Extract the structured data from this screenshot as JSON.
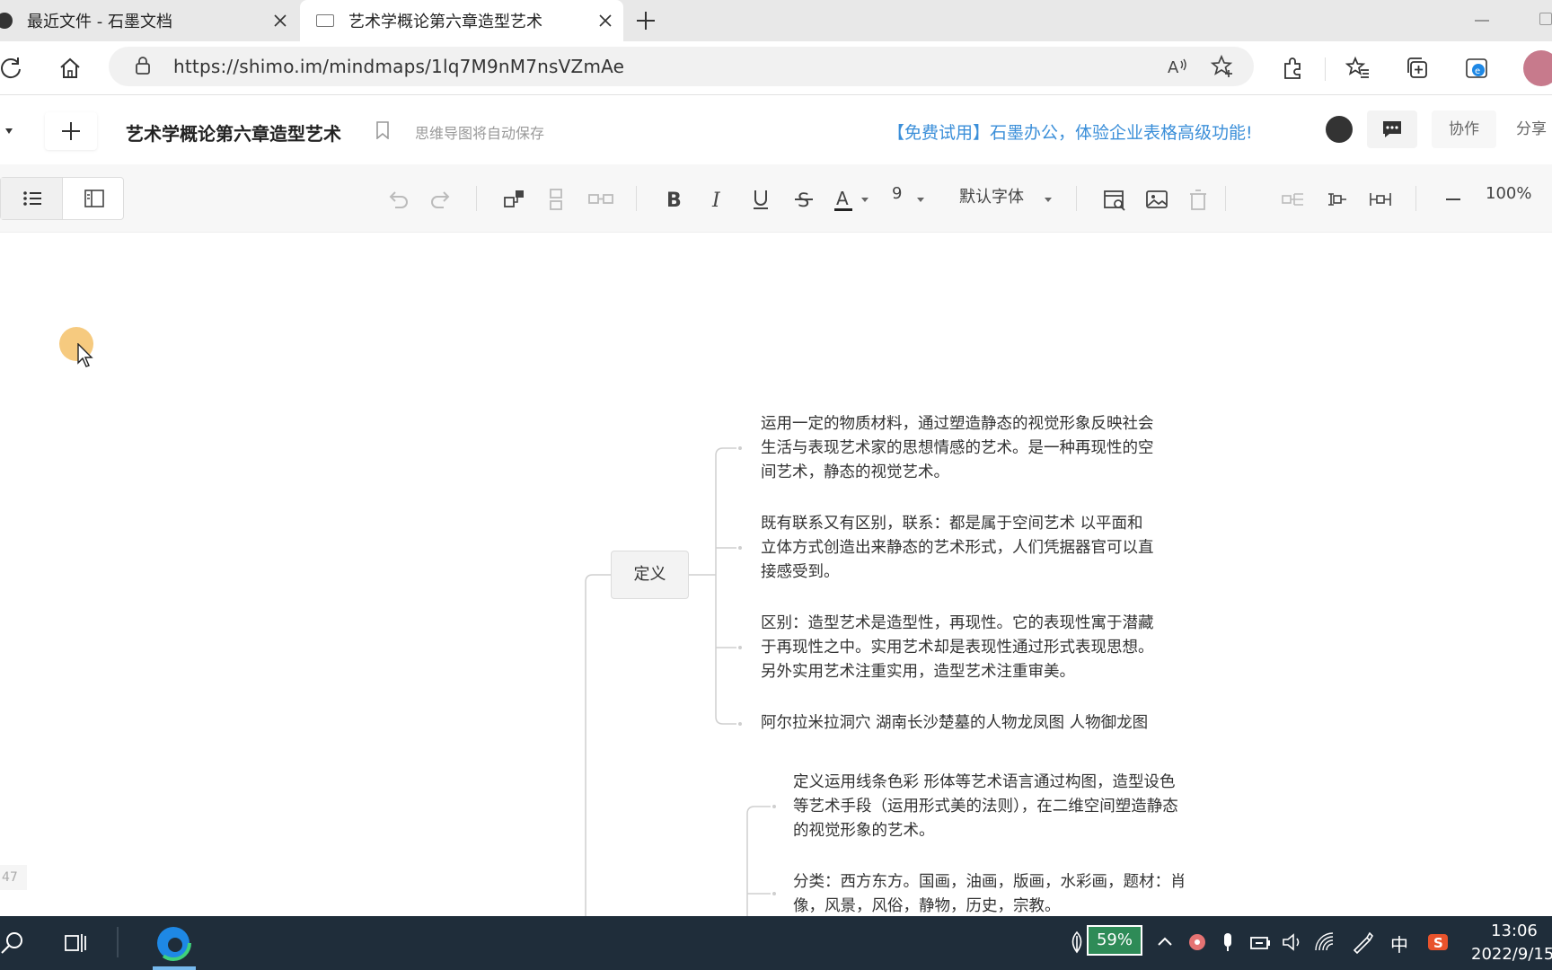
{
  "browser": {
    "tabs": [
      {
        "title": "最近文件 - 石墨文档",
        "active": false
      },
      {
        "title": "艺术学概论第六章造型艺术",
        "active": true
      }
    ],
    "url": "https://shimo.im/mindmaps/1lq7M9nM7nsVZmAe"
  },
  "header": {
    "doc_title": "艺术学概论第六章造型艺术",
    "autosave_hint": "思维导图将自动保存",
    "promo": "【免费试用】石墨办公，体验企业表格高级功能!",
    "collab_label": "协作",
    "share_label": "分享"
  },
  "toolbar": {
    "font_size": "9",
    "font_family": "默认字体",
    "zoom": "100%",
    "text_color": "#222222"
  },
  "mindmap": {
    "node_definition": "定义",
    "leaves_definition": [
      "运用一定的物质材料，通过塑造静态的视觉形象反映社会生活与表现艺术家的思想情感的艺术。是一种再现性的空间艺术，静态的视觉艺术。",
      "既有联系又有区别，联系：都是属于空间艺术 以平面和立体方式创造出来静态的艺术形式，人们凭据器官可以直接感受到。",
      "区别：造型艺术是造型性，再现性。它的表现性寓于潜藏于再现性之中。实用艺术却是表现性通过形式表现思想。另外实用艺术注重实用，造型艺术注重审美。",
      "阿尔拉米拉洞穴 湖南长沙楚墓的人物龙凤图 人物御龙图"
    ],
    "leaves_painting": [
      "定义运用线条色彩 形体等艺术语言通过构图，造型设色等艺术手段（运用形式美的法则），在二维空间塑造静态的视觉形象的艺术。",
      "分类：西方东方。国画，油画，版画，水彩画，题材：肖像，风景，风俗，静物，历史，宗教。"
    ],
    "leaf_lines_1": [
      "运用一定的物质材料，通过塑造静态的视觉形象反映社会",
      "生活与表现艺术家的思想情感的艺术。是一种再现性的空",
      "间艺术，静态的视觉艺术。"
    ],
    "leaf_lines_2": [
      "既有联系又有区别，联系：都是属于空间艺术 以平面和",
      "立体方式创造出来静态的艺术形式，人们凭据器官可以直",
      "接感受到。"
    ],
    "leaf_lines_3": [
      "区别：造型艺术是造型性，再现性。它的表现性寓于潜藏",
      "于再现性之中。实用艺术却是表现性通过形式表现思想。",
      "另外实用艺术注重实用，造型艺术注重审美。"
    ],
    "leaf_lines_4": [
      "阿尔拉米拉洞穴 湖南长沙楚墓的人物龙凤图 人物御龙图"
    ],
    "leaf_lines_5": [
      "定义运用线条色彩 形体等艺术语言通过构图，造型设色",
      "等艺术手段（运用形式美的法则），在二维空间塑造静态",
      "的视觉形象的艺术。"
    ],
    "leaf_lines_6": [
      "分类：西方东方。国画，油画，版画，水彩画，题材：肖",
      "像，风景，风俗，静物，历史，宗教。"
    ]
  },
  "side_counter": "47",
  "taskbar": {
    "battery": "59%",
    "ime": "中",
    "time": "13:06",
    "date": "2022/9/15"
  }
}
